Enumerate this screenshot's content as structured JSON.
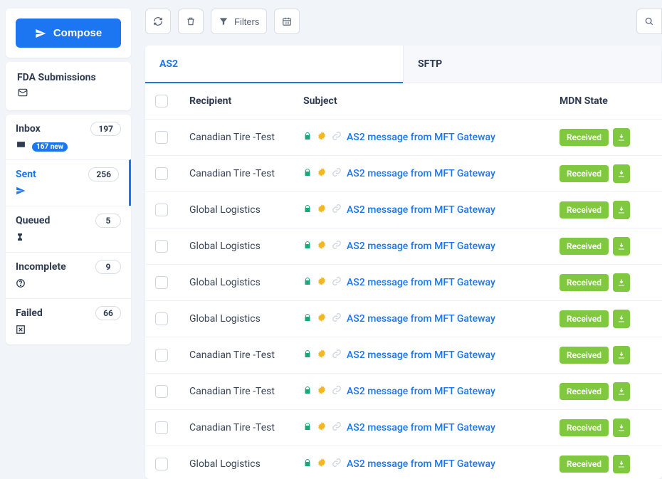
{
  "compose_label": "Compose",
  "sidebar_header": "FDA Submissions",
  "nav": [
    {
      "label": "Inbox",
      "count": "197",
      "new": "167 new",
      "icon": "inbox"
    },
    {
      "label": "Sent",
      "count": "256",
      "icon": "send",
      "active": true
    },
    {
      "label": "Queued",
      "count": "5",
      "icon": "hourglass"
    },
    {
      "label": "Incomplete",
      "count": "9",
      "icon": "help"
    },
    {
      "label": "Failed",
      "count": "66",
      "icon": "failed"
    }
  ],
  "filters_label": "Filters",
  "tabs": [
    {
      "label": "AS2",
      "active": true
    },
    {
      "label": "SFTP",
      "active": false
    }
  ],
  "columns": {
    "recipient": "Recipient",
    "subject": "Subject",
    "mdn": "MDN State"
  },
  "rows": [
    {
      "recipient": "Canadian Tire -Test",
      "subject": "AS2 message from MFT Gateway",
      "mdn": "Received"
    },
    {
      "recipient": "Canadian Tire -Test",
      "subject": "AS2 message from MFT Gateway",
      "mdn": "Received"
    },
    {
      "recipient": "Global Logistics",
      "subject": "AS2 message from MFT Gateway",
      "mdn": "Received"
    },
    {
      "recipient": "Global Logistics",
      "subject": "AS2 message from MFT Gateway",
      "mdn": "Received"
    },
    {
      "recipient": "Global Logistics",
      "subject": "AS2 message from MFT Gateway",
      "mdn": "Received"
    },
    {
      "recipient": "Global Logistics",
      "subject": "AS2 message from MFT Gateway",
      "mdn": "Received"
    },
    {
      "recipient": "Canadian Tire -Test",
      "subject": "AS2 message from MFT Gateway",
      "mdn": "Received"
    },
    {
      "recipient": "Canadian Tire -Test",
      "subject": "AS2 message from MFT Gateway",
      "mdn": "Received"
    },
    {
      "recipient": "Canadian Tire -Test",
      "subject": "AS2 message from MFT Gateway",
      "mdn": "Received"
    },
    {
      "recipient": "Global Logistics",
      "subject": "AS2 message from MFT Gateway",
      "mdn": "Received"
    }
  ]
}
